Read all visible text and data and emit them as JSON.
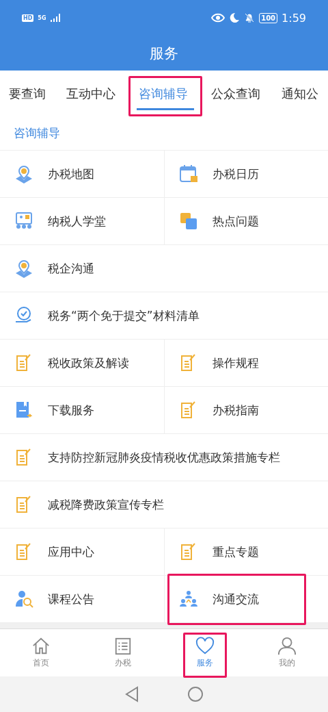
{
  "status_bar": {
    "hd": "HD",
    "network": "5G",
    "battery": "100",
    "time": "1:59"
  },
  "title": "服务",
  "tabs": [
    {
      "label": "要查询",
      "selected": false,
      "highlighted": false
    },
    {
      "label": "互动中心",
      "selected": false,
      "highlighted": false
    },
    {
      "label": "咨询辅导",
      "selected": true,
      "highlighted": true
    },
    {
      "label": "公众查询",
      "selected": false,
      "highlighted": false
    },
    {
      "label": "通知公",
      "selected": false,
      "highlighted": false
    }
  ],
  "section_title": "咨询辅导",
  "rows": [
    [
      {
        "label": "办税地图",
        "highlighted": false
      },
      {
        "label": "办税日历",
        "highlighted": false
      }
    ],
    [
      {
        "label": "纳税人学堂",
        "highlighted": false
      },
      {
        "label": "热点问题",
        "highlighted": false
      }
    ],
    [
      {
        "label": "税企沟通",
        "highlighted": false
      }
    ],
    [
      {
        "label": "税务“两个免于提交”材料清单",
        "highlighted": false
      }
    ],
    [
      {
        "label": "税收政策及解读",
        "highlighted": false
      },
      {
        "label": "操作规程",
        "highlighted": false
      }
    ],
    [
      {
        "label": "下载服务",
        "highlighted": false
      },
      {
        "label": "办税指南",
        "highlighted": false
      }
    ],
    [
      {
        "label": "支持防控新冠肺炎疫情税收优惠政策措施专栏",
        "highlighted": false
      }
    ],
    [
      {
        "label": "减税降费政策宣传专栏",
        "highlighted": false
      }
    ],
    [
      {
        "label": "应用中心",
        "highlighted": false
      },
      {
        "label": "重点专题",
        "highlighted": false
      }
    ],
    [
      {
        "label": "课程公告",
        "highlighted": false
      },
      {
        "label": "沟通交流",
        "highlighted": true
      }
    ]
  ],
  "bottom_nav": [
    {
      "label": "首页",
      "selected": false,
      "highlighted": false
    },
    {
      "label": "办税",
      "selected": false,
      "highlighted": false
    },
    {
      "label": "服务",
      "selected": true,
      "highlighted": true
    },
    {
      "label": "我的",
      "selected": false,
      "highlighted": false
    }
  ]
}
